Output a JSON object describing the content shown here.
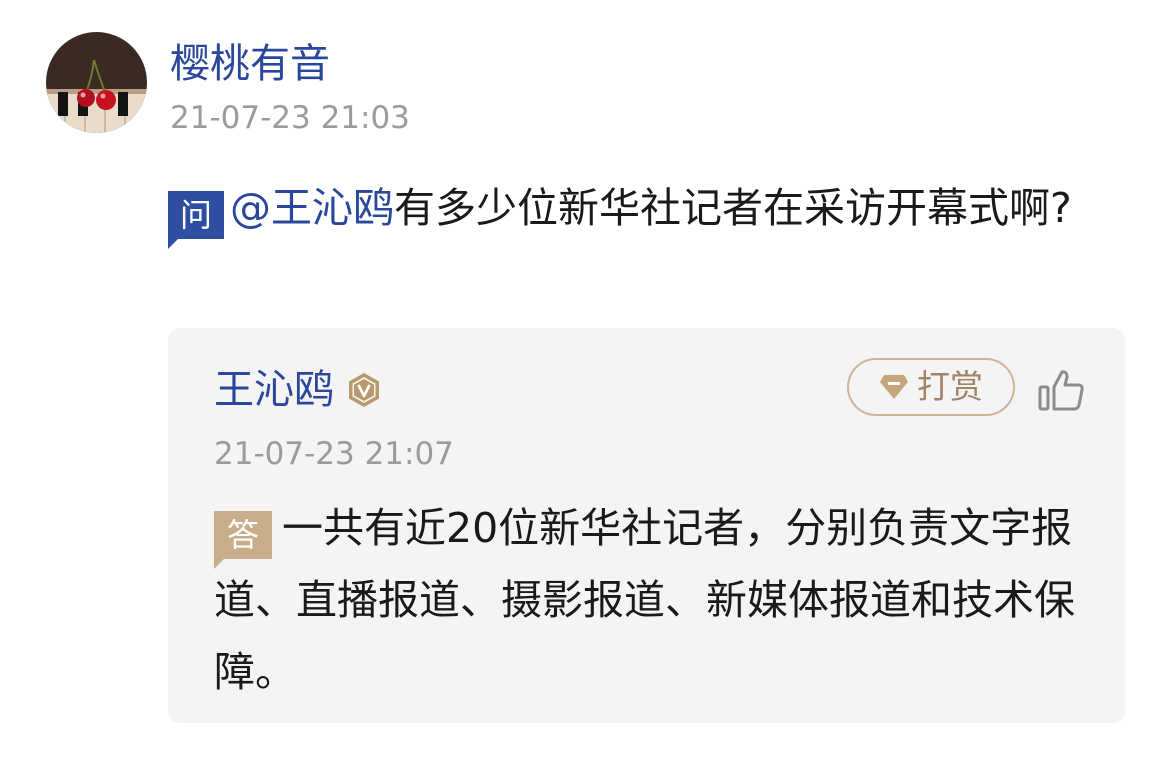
{
  "asker": {
    "name": "樱桃有音",
    "time": "21-07-23 21:03",
    "avatar": "cherry-on-piano-avatar"
  },
  "question": {
    "tag": "问",
    "mention": "@王沁鸥",
    "text": "有多少位新华社记者在采访开幕式啊?"
  },
  "answer": {
    "answerer_name": "王沁鸥",
    "verified_icon": "verified-v-icon",
    "tip_label": "打赏",
    "tip_icon": "gem-icon",
    "like_icon": "thumbs-up-icon",
    "time": "21-07-23 21:07",
    "tag": "答",
    "text": "一共有近20位新华社记者，分别负责文字报道、直播报道、摄影报道、新媒体报道和技术保障。"
  },
  "colors": {
    "link_blue": "#2b479c",
    "question_tag": "#2e4ea2",
    "answer_tag": "#c8ad8a",
    "tip_gold": "#a08467",
    "card_bg": "#f4f4f4",
    "meta_gray": "#9b9b9b"
  }
}
